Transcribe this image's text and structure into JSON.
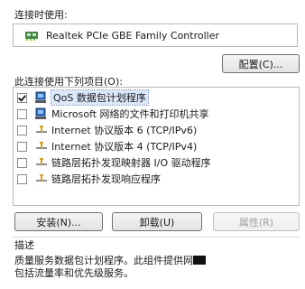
{
  "connect_using_label": "连接时使用:",
  "adapter": {
    "name": "Realtek PCIe GBE Family Controller",
    "icon": "network-adapter-icon"
  },
  "buttons": {
    "configure": "配置(C)...",
    "install": "安装(N)...",
    "uninstall": "卸载(U)",
    "properties": "属性(R)"
  },
  "items_label": "此连接使用下列项目(O):",
  "items": [
    {
      "label": "QoS 数据包计划程序",
      "checked": true,
      "icon": "qos-service-icon",
      "selected": true
    },
    {
      "label": "Microsoft 网络的文件和打印机共享",
      "checked": false,
      "icon": "file-print-sharing-icon"
    },
    {
      "label": "Internet 协议版本 6 (TCP/IPv6)",
      "checked": false,
      "icon": "protocol-icon"
    },
    {
      "label": "Internet 协议版本 4 (TCP/IPv4)",
      "checked": false,
      "icon": "protocol-icon"
    },
    {
      "label": "链路层拓扑发现映射器 I/O 驱动程序",
      "checked": false,
      "icon": "protocol-icon"
    },
    {
      "label": "链路层拓扑发现响应程序",
      "checked": false,
      "icon": "protocol-icon"
    }
  ],
  "description": {
    "title": "描述",
    "line1": "质量服务数据包计划程序。此组件提供网",
    "line2": "包括流量率和优先级服务。"
  }
}
